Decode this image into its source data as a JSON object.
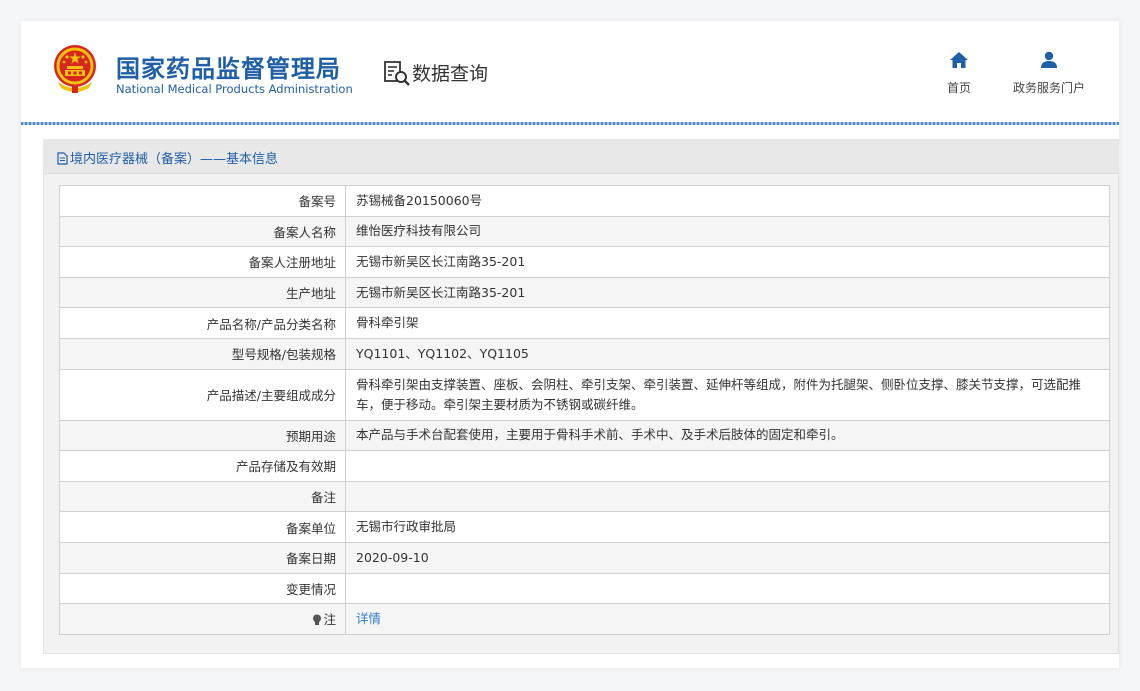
{
  "header": {
    "org_name_cn": "国家药品监督管理局",
    "org_name_en": "National Medical Products Administration",
    "query_label": "数据查询",
    "nav": [
      {
        "label": "首页",
        "icon": "home-icon"
      },
      {
        "label": "政务服务门户",
        "icon": "user-icon"
      }
    ]
  },
  "section": {
    "title": "境内医疗器械（备案）——基本信息"
  },
  "records": [
    {
      "label": "备案号",
      "value": "苏锡械备20150060号"
    },
    {
      "label": "备案人名称",
      "value": "维怡医疗科技有限公司"
    },
    {
      "label": "备案人注册地址",
      "value": "无锡市新吴区长江南路35-201"
    },
    {
      "label": "生产地址",
      "value": "无锡市新吴区长江南路35-201"
    },
    {
      "label": "产品名称/产品分类名称",
      "value": "骨科牵引架"
    },
    {
      "label": "型号规格/包装规格",
      "value": "YQ1101、YQ1102、YQ1105"
    },
    {
      "label": "产品描述/主要组成成分",
      "value": "骨科牵引架由支撑装置、座板、会阴柱、牵引支架、牵引装置、延伸杆等组成，附件为托腿架、侧卧位支撑、膝关节支撑，可选配推车，便于移动。牵引架主要材质为不锈钢或碳纤维。"
    },
    {
      "label": "预期用途",
      "value": "本产品与手术台配套使用，主要用于骨科手术前、手术中、及手术后肢体的固定和牵引。"
    },
    {
      "label": "产品存储及有效期",
      "value": ""
    },
    {
      "label": "备注",
      "value": ""
    },
    {
      "label": "备案单位",
      "value": "无锡市行政审批局"
    },
    {
      "label": "备案日期",
      "value": "2020-09-10"
    },
    {
      "label": "变更情况",
      "value": ""
    },
    {
      "label": "注",
      "value": "详情",
      "icon": "bulb-icon"
    }
  ],
  "colors": {
    "brand_blue": "#1f5fa8",
    "link_blue": "#2f7dc9",
    "emblem_red": "#d7261e",
    "emblem_gold": "#f4c20d"
  }
}
